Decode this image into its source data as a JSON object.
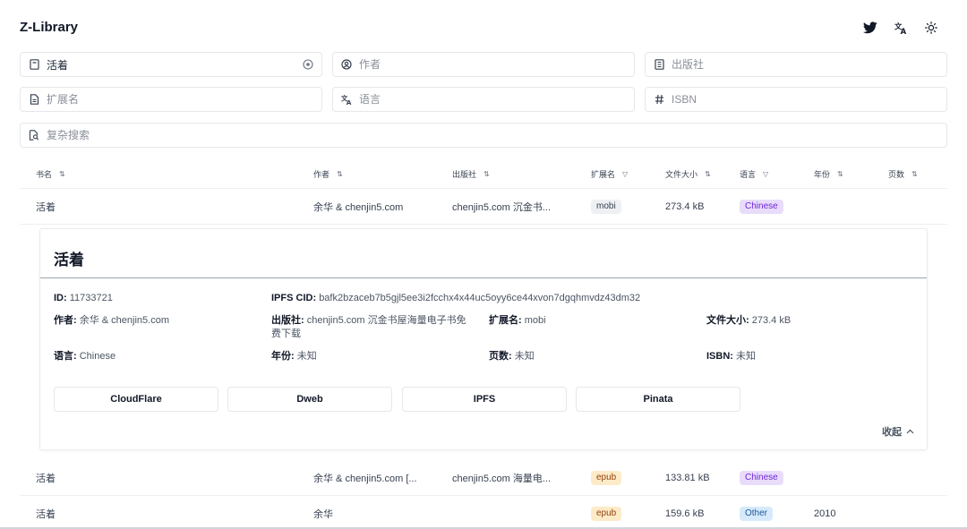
{
  "app": {
    "title": "Z-Library"
  },
  "header_icons": [
    "twitter-icon",
    "translate-icon",
    "sun-icon"
  ],
  "search": {
    "title": {
      "value": "活着",
      "placeholder": ""
    },
    "author": {
      "value": "",
      "placeholder": "作者"
    },
    "publisher": {
      "value": "",
      "placeholder": "出版社"
    },
    "extension": {
      "value": "",
      "placeholder": "扩展名"
    },
    "language": {
      "value": "",
      "placeholder": "语言"
    },
    "isbn": {
      "value": "",
      "placeholder": "ISBN"
    },
    "complex": {
      "value": "",
      "placeholder": "复杂搜索"
    }
  },
  "table": {
    "headers": {
      "title": "书名",
      "author": "作者",
      "publisher": "出版社",
      "extension": "扩展名",
      "size": "文件大小",
      "language": "语言",
      "year": "年份",
      "pages": "页数"
    },
    "sort_glyph": "⇅",
    "filter_glyph": "▽",
    "rows": [
      {
        "title": "活着",
        "author": "余华 & chenjin5.com",
        "publisher": "chenjin5.com 沉金书...",
        "extension": "mobi",
        "size": "273.4 kB",
        "language": "Chinese",
        "year": "",
        "pages": ""
      },
      {
        "title": "活着",
        "author": "余华 & chenjin5.com [...",
        "publisher": "chenjin5.com 海量电...",
        "extension": "epub",
        "size": "133.81 kB",
        "language": "Chinese",
        "year": "",
        "pages": ""
      },
      {
        "title": "活着",
        "author": "余华",
        "publisher": "",
        "extension": "epub",
        "size": "159.6 kB",
        "language": "Other",
        "year": "2010",
        "pages": ""
      }
    ]
  },
  "detail": {
    "title": "活着",
    "id_label": "ID:",
    "id_value": "11733721",
    "ipfs_label": "IPFS CID:",
    "ipfs_value": "bafk2bzaceb7b5gjl5ee3i2fcchx4x44uc5oyy6ce44xvon7dgqhmvdz43dm32",
    "author_label": "作者:",
    "author_value": "余华 & chenjin5.com",
    "publisher_label": "出版社:",
    "publisher_value": "chenjin5.com 沉金书屋海量电子书免费下载",
    "extension_label": "扩展名:",
    "extension_value": "mobi",
    "size_label": "文件大小:",
    "size_value": "273.4 kB",
    "language_label": "语言:",
    "language_value": "Chinese",
    "year_label": "年份:",
    "year_value": "未知",
    "pages_label": "页数:",
    "pages_value": "未知",
    "isbn_label": "ISBN:",
    "isbn_value": "未知",
    "downloads": [
      "CloudFlare",
      "Dweb",
      "IPFS",
      "Pinata"
    ],
    "collapse_label": "收起"
  }
}
